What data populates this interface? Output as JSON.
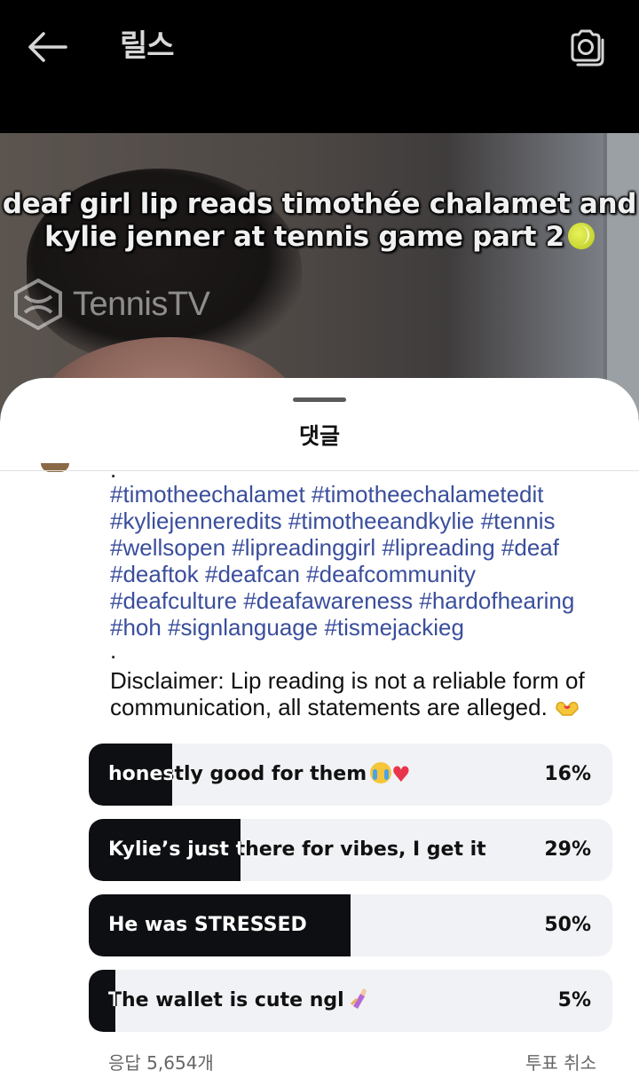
{
  "header": {
    "title": "릴스",
    "back_icon": "arrow-left-icon",
    "camera_icon": "camera-icon"
  },
  "video": {
    "caption_line1": "deaf girl lip reads timothée chalamet and",
    "caption_line2": "kylie jenner at tennis game part 2",
    "caption_emoji": "tennis-ball-emoji",
    "watermark": "TennisTV"
  },
  "sheet": {
    "title": "댓글",
    "caption": {
      "dot1": ".",
      "hashtags": [
        "#timotheechalamet",
        "#timotheechalametedit",
        "#kyliejenneredits",
        "#timotheeandkylie",
        "#tennis",
        "#wellsopen",
        "#lipreadinggirl",
        "#lipreading",
        "#deaf",
        "#deaftok",
        "#deafcan",
        "#deafcommunity",
        "#deafculture",
        "#deafawareness",
        "#hardofhearing",
        "#hoh",
        "#signlanguage",
        "#tismejackieg"
      ],
      "dot2": ".",
      "disclaimer": "Disclaimer: Lip reading is not a reliable form of communication, all statements are alleged.",
      "disclaimer_emoji": "heart-hands-emoji"
    },
    "poll": {
      "options": [
        {
          "label": "honestly good for them",
          "emojis": [
            "crying-face-emoji",
            "red-heart-emoji"
          ],
          "percent_text": "16%",
          "percent": 16
        },
        {
          "label": "Kylie’s just there for vibes, I get it",
          "emojis": [],
          "percent_text": "29%",
          "percent": 29
        },
        {
          "label": "He was STRESSED",
          "emojis": [],
          "percent_text": "50%",
          "percent": 50
        },
        {
          "label": "The wallet is cute ngl",
          "emojis": [
            "nail-polish-emoji"
          ],
          "percent_text": "5%",
          "percent": 5
        }
      ],
      "votes": "응답 5,654개",
      "cancel": "투표 취소"
    }
  }
}
